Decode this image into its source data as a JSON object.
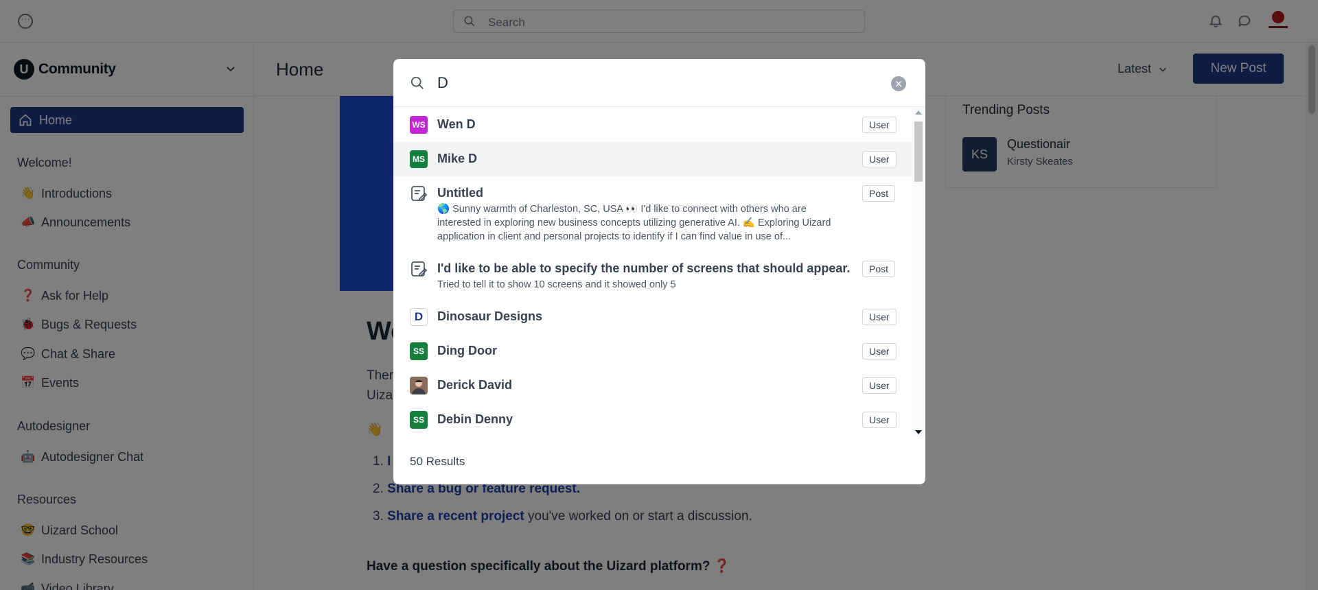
{
  "topbar": {
    "search_placeholder": "Search"
  },
  "sidebar": {
    "brand": "Community",
    "home": "Home",
    "sections": [
      {
        "title": "Welcome!",
        "items": [
          {
            "emoji": "👋",
            "label": "Introductions"
          },
          {
            "emoji": "📣",
            "label": "Announcements"
          }
        ]
      },
      {
        "title": "Community",
        "items": [
          {
            "emoji": "❓",
            "label": "Ask for Help"
          },
          {
            "emoji": "🐞",
            "label": "Bugs & Requests"
          },
          {
            "emoji": "💬",
            "label": "Chat & Share"
          },
          {
            "emoji": "📅",
            "label": "Events"
          }
        ]
      },
      {
        "title": "Autodesigner",
        "items": [
          {
            "emoji": "🤖",
            "label": "Autodesigner Chat"
          }
        ]
      },
      {
        "title": "Resources",
        "items": [
          {
            "emoji": "🤓",
            "label": "Uizard School"
          },
          {
            "emoji": "📚",
            "label": "Industry Resources"
          },
          {
            "emoji": "📹",
            "label": "Video Library"
          }
        ]
      }
    ]
  },
  "main": {
    "title": "Home",
    "sort": "Latest",
    "new_post": "New Post",
    "welcome_heading": "We",
    "line1": "Ther",
    "line2": "Uiza",
    "wave": "👋",
    "ol": [
      {
        "num": "1.",
        "link": "I",
        "rest": ""
      },
      {
        "num": "2.",
        "link": "Share a bug or feature request.",
        "rest": ""
      },
      {
        "num": "3.",
        "link": "Share a recent project",
        "rest": " you've worked on or start a discussion."
      }
    ],
    "question": "Have a question specifically about the Uizard platform? ❓"
  },
  "trending": {
    "title": "Trending Posts",
    "post": {
      "initials": "KS",
      "title": "Questionair",
      "author": "Kirsty Skeates"
    }
  },
  "search_modal": {
    "query": "D",
    "results_count": "50 Results",
    "results": [
      {
        "type": "User",
        "initials": "WS",
        "color": "#c026d3",
        "name": "Wen D"
      },
      {
        "type": "User",
        "initials": "MS",
        "color": "#15803d",
        "name": "Mike D"
      },
      {
        "type": "Post",
        "name": "Untitled",
        "snippet": "🌎  Sunny warmth of Charleston, SC, USA 👀  I'd like to connect with others who are interested in exploring new business concepts utilizing generative AI.  ✍️  Exploring Uizard application in client and personal projects to identify if I can find value in use of..."
      },
      {
        "type": "Post",
        "name": "I'd like to be able to specify the number of screens that should appear.",
        "snippet": "Tried to tell it to show 10 screens and it showed only 5"
      },
      {
        "type": "User",
        "initials": "D",
        "color": "#ffffff",
        "name": "Dinosaur Designs"
      },
      {
        "type": "User",
        "initials": "SS",
        "color": "#15803d",
        "name": "Ding Door"
      },
      {
        "type": "User",
        "initials": "",
        "color": "#8b6b5c",
        "name": "Derick David"
      },
      {
        "type": "User",
        "initials": "SS",
        "color": "#15803d",
        "name": "Debin Denny"
      }
    ]
  }
}
